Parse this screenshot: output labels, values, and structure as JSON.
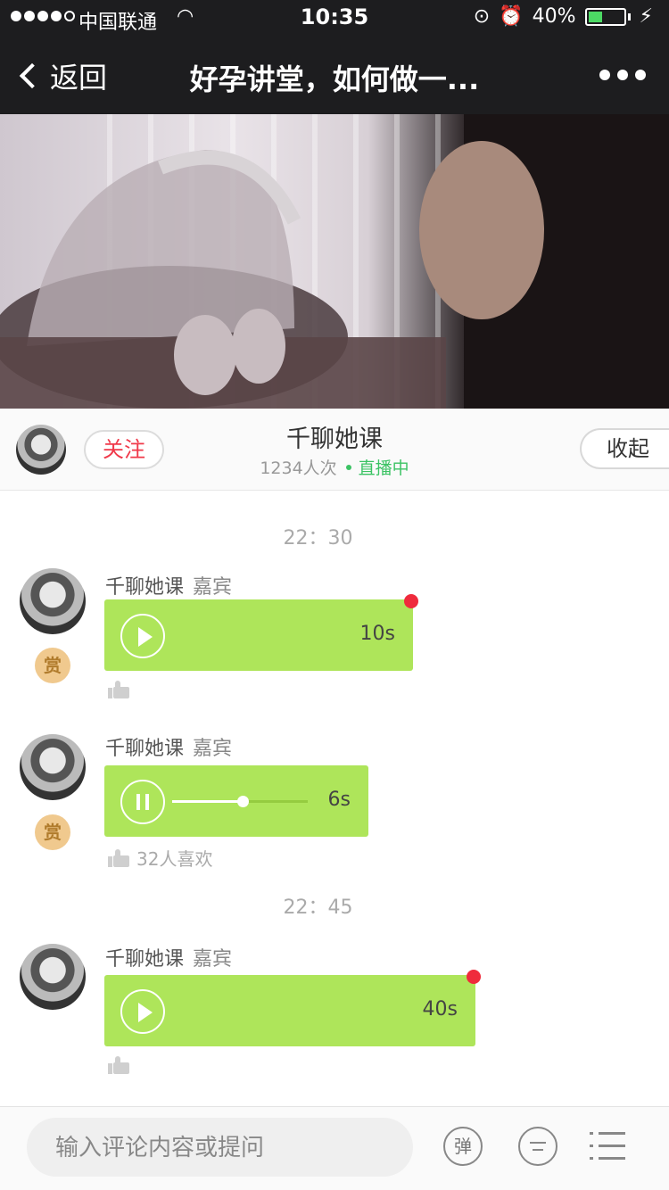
{
  "status_bar": {
    "carrier": "中国联通",
    "time": "10:35",
    "battery_text": "40%",
    "battery_level": 0.4
  },
  "nav": {
    "back_label": "返回",
    "title": "好孕讲堂，如何做一..."
  },
  "host": {
    "follow_label": "关注",
    "name": "千聊她课",
    "views": "1234人次",
    "live_status": "直播中",
    "collapse_label": "收起"
  },
  "feed": {
    "times": [
      "22：30",
      "22：45"
    ],
    "messages": [
      {
        "sender": "千聊她课",
        "role": "嘉宾",
        "duration": "10s",
        "reward": "赏",
        "likes": "",
        "state": "unplayed"
      },
      {
        "sender": "千聊她课",
        "role": "嘉宾",
        "duration": "6s",
        "reward": "赏",
        "likes": "32人喜欢",
        "state": "playing",
        "progress": 0.52
      },
      {
        "sender": "千聊她课",
        "role": "嘉宾",
        "duration": "40s",
        "reward": "",
        "likes": "",
        "state": "unplayed"
      }
    ]
  },
  "bottom_bar": {
    "input_placeholder": "输入评论内容或提问",
    "danmaku_label": "弹"
  },
  "colors": {
    "bubble": "#aee55a",
    "live": "#3cc364",
    "follow": "#f0394a",
    "unread": "#ef2b3c"
  }
}
